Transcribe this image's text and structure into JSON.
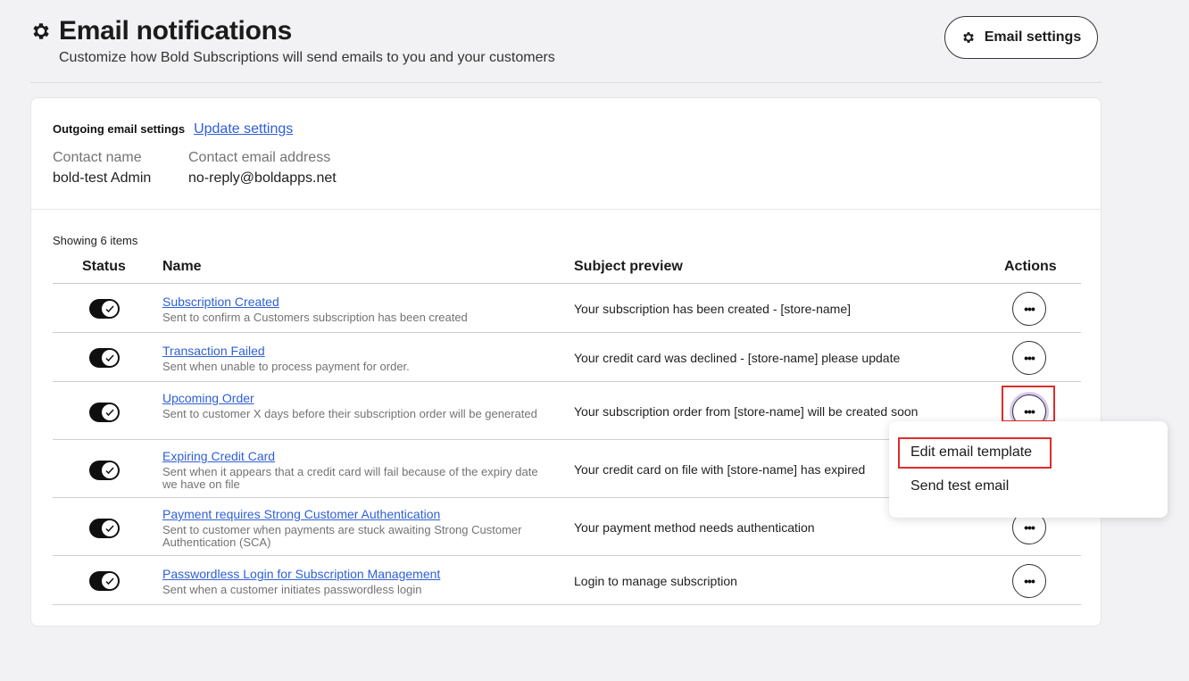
{
  "header": {
    "title": "Email notifications",
    "subtitle": "Customize how Bold Subscriptions will send emails to you and your customers",
    "settings_button": "Email settings"
  },
  "outgoing": {
    "label": "Outgoing email settings",
    "update_link": "Update settings",
    "contact_name_label": "Contact name",
    "contact_name": "bold-test Admin",
    "contact_email_label": "Contact email address",
    "contact_email": "no-reply@boldapps.net"
  },
  "table": {
    "showing": "Showing 6 items",
    "headers": {
      "status": "Status",
      "name": "Name",
      "subject": "Subject preview",
      "actions": "Actions"
    },
    "rows": [
      {
        "name": "Subscription Created",
        "desc": "Sent to confirm a Customers subscription has been created",
        "subject": "Your subscription has been created - [store-name]",
        "enabled": true
      },
      {
        "name": "Transaction Failed",
        "desc": "Sent when unable to process payment for order.",
        "subject": "Your credit card was declined - [store-name] please update",
        "enabled": true
      },
      {
        "name": "Upcoming Order",
        "desc": "Sent to customer X days before their subscription order will be generated",
        "subject": "Your subscription order from [store-name] will be created soon",
        "enabled": true
      },
      {
        "name": "Expiring Credit Card",
        "desc": "Sent when it appears that a credit card will fail because of the expiry date we have on file",
        "subject": "Your credit card on file with [store-name] has expired",
        "enabled": true
      },
      {
        "name": "Payment requires Strong Customer Authentication",
        "desc": "Sent to customer when payments are stuck awaiting Strong Customer Authentication (SCA)",
        "subject": "Your payment method needs authentication",
        "enabled": true
      },
      {
        "name": "Passwordless Login for Subscription Management",
        "desc": "Sent when a customer initiates passwordless login",
        "subject": "Login to manage subscription",
        "enabled": true
      }
    ],
    "action_glyph": "•••"
  },
  "menu": {
    "items": [
      "Edit email template",
      "Send test email"
    ]
  },
  "colors": {
    "link": "#2f5fd6",
    "highlight": "#e02b2b",
    "toggle_on": "#0f0f0f"
  }
}
